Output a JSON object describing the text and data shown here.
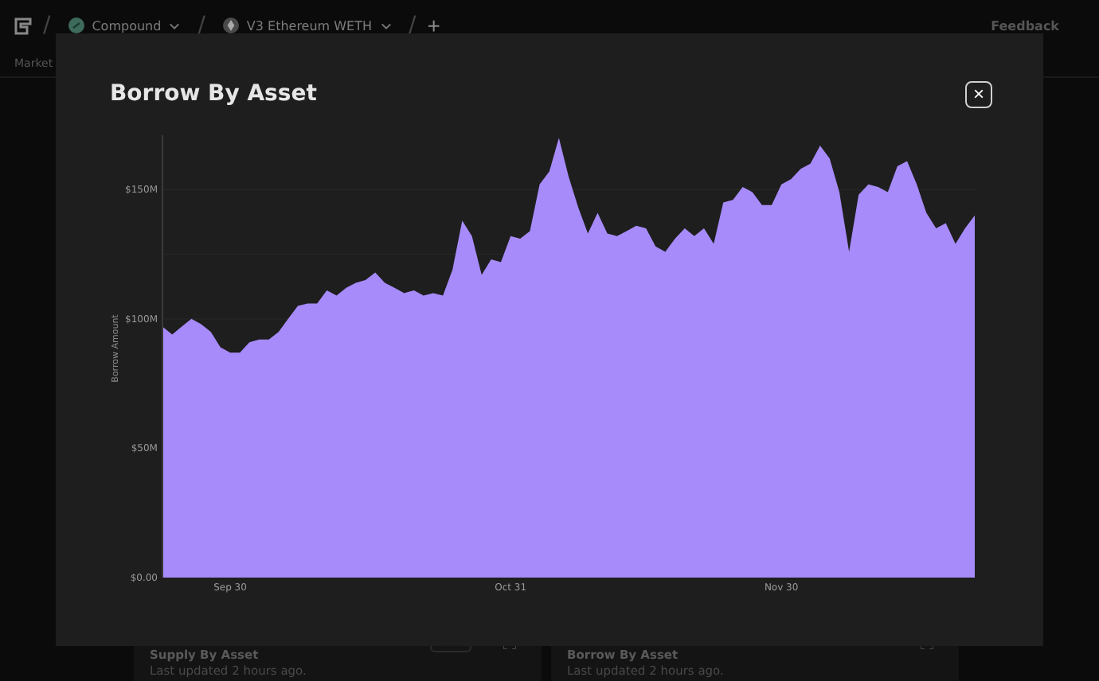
{
  "topbar": {
    "separators": [
      "/",
      "/",
      "/"
    ],
    "crumbs": [
      {
        "label": "Compound"
      },
      {
        "label": "V3 Ethereum WETH"
      }
    ],
    "add_label": "+",
    "feedback": "Feedback"
  },
  "market_label": "Market",
  "cards": [
    {
      "title": "Supply By Asset",
      "subtitle": "Last updated 2 hours ago."
    },
    {
      "title": "Borrow By Asset",
      "subtitle": "Last updated 2 hours ago."
    }
  ],
  "modal": {
    "title": "Borrow By Asset",
    "close_label": "×",
    "chart_data": {
      "type": "area",
      "ylabel": "Borrow Amount",
      "ylim": [
        0,
        171
      ],
      "categories": [
        null,
        null,
        null,
        null,
        null,
        null,
        null,
        "Sep 30",
        null,
        null,
        null,
        null,
        null,
        null,
        null,
        null,
        null,
        null,
        null,
        null,
        null,
        null,
        null,
        null,
        null,
        null,
        null,
        null,
        null,
        null,
        null,
        null,
        null,
        null,
        null,
        null,
        "Oct 31",
        null,
        null,
        null,
        null,
        null,
        null,
        null,
        null,
        null,
        null,
        null,
        null,
        null,
        null,
        null,
        null,
        null,
        null,
        null,
        null,
        null,
        null,
        null,
        null,
        null,
        null,
        null,
        "Nov 30",
        null,
        null,
        null,
        null,
        null,
        null,
        null,
        null,
        null,
        null,
        null,
        null,
        null,
        null,
        null,
        null,
        null,
        null,
        null,
        null
      ],
      "yticks": [
        {
          "value": 0,
          "label": "$0.00"
        },
        {
          "value": 50,
          "label": "$50M"
        },
        {
          "value": 100,
          "label": "$100M"
        },
        {
          "value": 150,
          "label": "$150M"
        }
      ],
      "series": [
        {
          "color": "#a78bfa",
          "values": [
            97,
            94,
            97,
            100,
            98,
            95,
            89,
            87,
            87,
            91,
            92,
            92,
            95,
            100,
            105,
            106,
            106,
            111,
            109,
            112,
            114,
            115,
            118,
            114,
            112,
            110,
            111,
            109,
            110,
            109,
            119,
            138,
            132,
            117,
            123,
            122,
            132,
            131,
            134,
            152,
            157,
            170,
            155,
            143,
            133,
            141,
            133,
            132,
            134,
            136,
            135,
            128,
            126,
            131,
            135,
            132,
            135,
            129,
            145,
            146,
            151,
            149,
            144,
            144,
            152,
            154,
            158,
            160,
            167,
            162,
            149,
            126,
            148,
            152,
            151,
            149,
            159,
            161,
            152,
            141,
            135,
            137,
            129,
            135,
            140
          ]
        }
      ]
    }
  }
}
